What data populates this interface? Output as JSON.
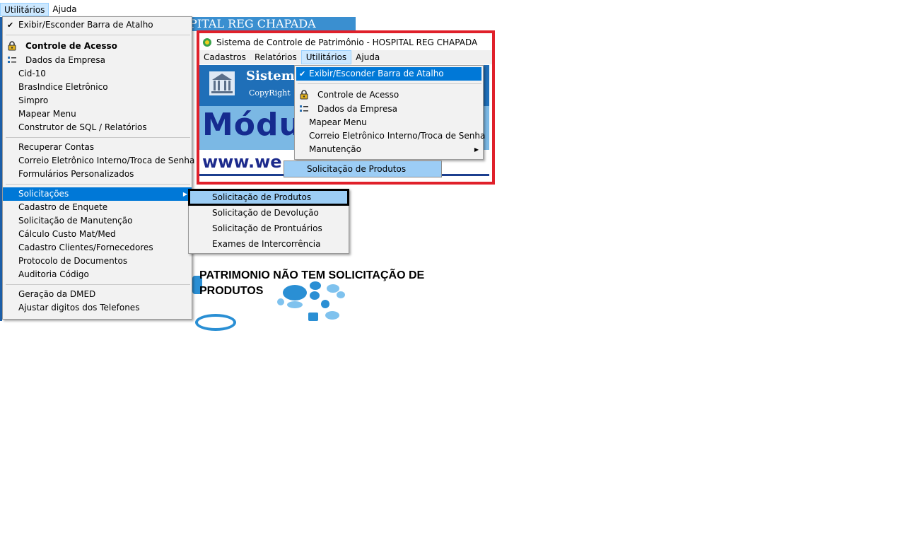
{
  "background_app": {
    "title_fragment": "PITAL REG CHAPADA",
    "top_menu": [
      "Utilitários",
      "Ajuda"
    ]
  },
  "main_menu": {
    "items": [
      {
        "label": "Exibir/Esconder Barra de Atalho",
        "checked": true
      },
      {
        "label": "Controle de Acesso",
        "icon": "lock-icon",
        "bold": true
      },
      {
        "label": "Dados da Empresa",
        "icon": "list-icon"
      },
      {
        "label": "Cid-10"
      },
      {
        "label": "BrasIndice Eletrônico"
      },
      {
        "label": "Simpro"
      },
      {
        "label": "Mapear Menu"
      },
      {
        "label": "Construtor de SQL / Relatórios"
      },
      {
        "label": "Recuperar Contas"
      },
      {
        "label": "Correio Eletrônico Interno/Troca de Senha"
      },
      {
        "label": "Formulários Personalizados"
      },
      {
        "label": "Solicitações",
        "has_submenu": true,
        "highlighted": true
      },
      {
        "label": "Cadastro de Enquete"
      },
      {
        "label": "Solicitação de Manutenção"
      },
      {
        "label": "Cálculo Custo Mat/Med"
      },
      {
        "label": "Cadastro Clientes/Fornecedores"
      },
      {
        "label": "Protocolo de Documentos"
      },
      {
        "label": "Auditoria Código"
      },
      {
        "label": "Geração da DMED"
      },
      {
        "label": "Ajustar digitos dos Telefones"
      }
    ]
  },
  "solicitacoes_submenu": {
    "items": [
      {
        "label": "Solicitação de Produtos",
        "highlighted": true
      },
      {
        "label": "Solicitação de Devolução"
      },
      {
        "label": "Solicitação de Prontuários"
      },
      {
        "label": "Exames de Intercorrência"
      }
    ]
  },
  "inset": {
    "window_title": "Sistema de Controle de Patrimônio - HOSPITAL REG CHAPADA",
    "menubar": [
      "Cadastros",
      "Relatórios",
      "Utilitários",
      "Ajuda"
    ],
    "banner_sistem": "Sistem",
    "banner_copyright": "CopyRight",
    "banner_modulo": "Módu",
    "banner_www": "www.we",
    "menu_items": [
      {
        "label": "Exibir/Esconder Barra de Atalho",
        "checked": true,
        "highlighted": true
      },
      {
        "label": "Controle de Acesso",
        "icon": "lock-icon"
      },
      {
        "label": "Dados da Empresa",
        "icon": "list-icon"
      },
      {
        "label": "Mapear Menu"
      },
      {
        "label": "Correio Eletrônico Interno/Troca de Senha"
      },
      {
        "label": "Manutenção",
        "has_submenu": true
      }
    ],
    "submenu_item": "Solicitação de Produtos"
  },
  "note": "PATRIMONIO NÃO TEM SOLICITAÇÃO DE PRODUTOS",
  "colors": {
    "highlight": "#0078d7",
    "submenu_highlight": "#9ccdf5",
    "inset_border": "#e0202a",
    "menu_bg": "#f2f2f2"
  }
}
